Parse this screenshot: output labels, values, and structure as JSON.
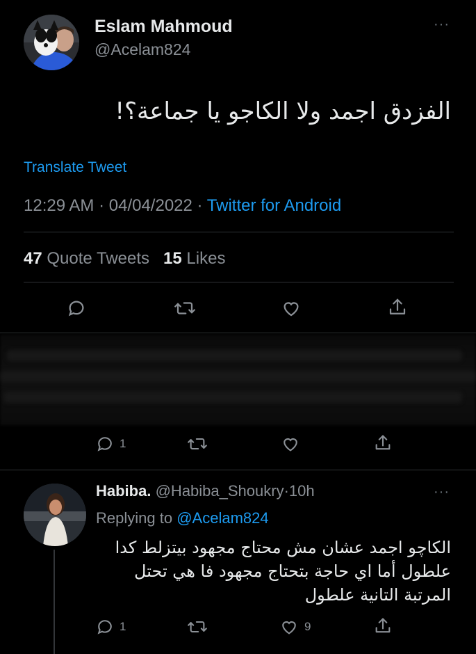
{
  "main_tweet": {
    "author_name": "Eslam Mahmoud",
    "author_handle": "@Acelam824",
    "more_label": "···",
    "text": "الفزدق اجمد ولا الكاجو يا جماعة؟!",
    "translate_label": "Translate Tweet",
    "time": "12:29 AM",
    "separator": "·",
    "date": "04/04/2022",
    "source": "Twitter for Android",
    "quote_count": "47",
    "quote_label": "Quote Tweets",
    "like_count": "15",
    "like_label": "Likes"
  },
  "redacted_reply": {
    "reply_count": "1"
  },
  "reply_tweet": {
    "author_name": "Habiba.",
    "author_handle": "@Habiba_Shoukry",
    "separator": "·",
    "time_ago": "10h",
    "more_label": "···",
    "replying_prefix": "Replying to",
    "replying_handle": "@Acelam824",
    "text_lines": [
      "الكاچو اجمد عشان مش محتاج مجهود بيتزلط كدا",
      "علطول أما اي حاجة بتحتاج مجهود فا هي تحتل",
      "المرتبة التانية علطول"
    ],
    "reply_count": "1",
    "like_count": "9"
  },
  "colors": {
    "background": "#000000",
    "text_primary": "#e7e9ea",
    "text_secondary": "#8b9096",
    "accent_blue": "#1d9bf0",
    "divider": "#2f3336"
  },
  "icons": [
    "reply-icon",
    "retweet-icon",
    "like-icon",
    "share-icon",
    "more-icon"
  ]
}
